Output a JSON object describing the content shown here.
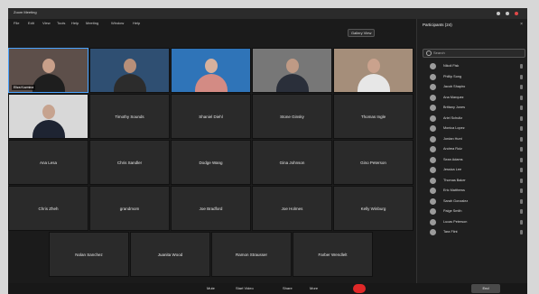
{
  "window": {
    "title": "Zoom Meeting",
    "controls": {
      "minimize": "min-icon",
      "maximize": "max-icon",
      "close": "close-icon"
    }
  },
  "menu": [
    "File",
    "Edit",
    "View",
    "Tools",
    "Help",
    "Meeting",
    "Window",
    "Help"
  ],
  "toolbar": {
    "view_label": "Gallery View"
  },
  "gallery": {
    "video_tiles": [
      {
        "name": "Eliza Kuzmina",
        "speaking": true
      },
      {
        "name": "",
        "speaking": false
      },
      {
        "name": "",
        "speaking": false
      },
      {
        "name": "",
        "speaking": false
      },
      {
        "name": "",
        "speaking": false
      },
      {
        "name": "",
        "speaking": false
      }
    ],
    "name_tiles": [
      "Timothy Sounds",
      "Shaniel Diehl",
      "Stone Ginsky",
      "Thomas Ingle",
      "Ana Lesa",
      "Chris Sandler",
      "Dodge Wang",
      "Gina Johnson",
      "Gino Peterson",
      "Chris Zheh",
      "grandmom",
      "Joe Bradford",
      "Joe Holmes",
      "Kelly Winburg",
      "Nolan Sanchez",
      "Juanita Wood",
      "Ramon Strausser",
      "Farber Wendlelt"
    ]
  },
  "sidebar": {
    "title": "Participants (24)",
    "search_placeholder": "Search",
    "participants": [
      "Nikoli Fisk",
      "Phillip Song",
      "Jacob Shapiro",
      "Ana Marquez",
      "Brittany Jones",
      "Ariel Schultz",
      "Monica Lopez",
      "Jordan Hunt",
      "Andrea Ruiz",
      "Sean Adams",
      "Jessica Lee",
      "Thomas Baker",
      "Eric Matthews",
      "Sarah Gonzalez",
      "Paige Smith",
      "Lucas Peterson",
      "Tara Flint"
    ]
  },
  "controls": {
    "buttons": [
      "Mute",
      "Start Video",
      "Share",
      "More"
    ],
    "end_label": "End"
  }
}
